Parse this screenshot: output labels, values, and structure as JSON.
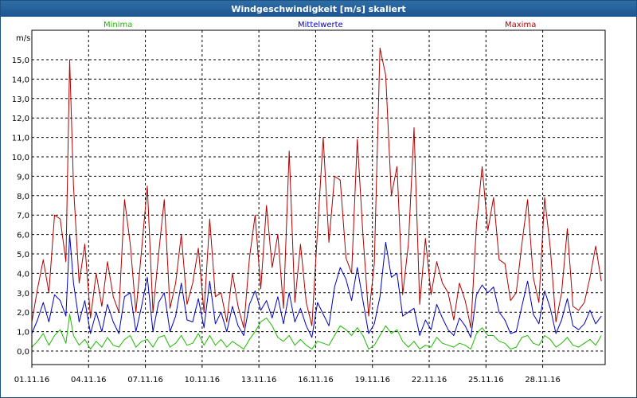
{
  "window": {
    "title": "Windgeschwindigkeit [m/s] skaliert"
  },
  "chart_data": {
    "type": "line",
    "title": "Windgeschwindigkeit [m/s] skaliert",
    "ylabel": "m/s",
    "xlabel": "",
    "ylim": [
      0,
      16
    ],
    "y_ticks": [
      "0,0",
      "1,0",
      "2,0",
      "3,0",
      "4,0",
      "5,0",
      "6,0",
      "7,0",
      "8,0",
      "9,0",
      "10,0",
      "11,0",
      "12,0",
      "13,0",
      "14,0",
      "15,0"
    ],
    "x_ticks": [
      "01.11.16",
      "04.11.16",
      "07.11.16",
      "10.11.16",
      "13.11.16",
      "16.11.16",
      "19.11.16",
      "22.11.16",
      "25.11.16",
      "28.11.16"
    ],
    "grid": true,
    "legend": "top",
    "x_day_range": [
      1,
      31.3
    ],
    "series": [
      {
        "name": "Minima",
        "color": "#1fb800",
        "x": [
          1.0,
          1.3,
          1.6,
          1.9,
          2.2,
          2.5,
          2.8,
          3.0,
          3.2,
          3.5,
          3.8,
          4.1,
          4.4,
          4.7,
          5.0,
          5.3,
          5.6,
          5.9,
          6.2,
          6.5,
          6.8,
          7.1,
          7.4,
          7.7,
          8.0,
          8.3,
          8.6,
          8.9,
          9.2,
          9.5,
          9.8,
          10.1,
          10.4,
          10.7,
          11.0,
          11.3,
          11.6,
          11.9,
          12.2,
          12.5,
          12.8,
          13.1,
          13.4,
          13.7,
          14.0,
          14.3,
          14.6,
          14.9,
          15.2,
          15.5,
          15.8,
          16.1,
          16.4,
          16.7,
          17.0,
          17.3,
          17.6,
          17.9,
          18.2,
          18.5,
          18.8,
          19.1,
          19.4,
          19.7,
          20.0,
          20.3,
          20.6,
          20.9,
          21.2,
          21.5,
          21.8,
          22.1,
          22.4,
          22.7,
          23.0,
          23.3,
          23.6,
          23.9,
          24.2,
          24.5,
          24.8,
          25.1,
          25.4,
          25.7,
          26.0,
          26.3,
          26.6,
          26.9,
          27.2,
          27.5,
          27.8,
          28.1,
          28.4,
          28.7,
          29.0,
          29.3,
          29.6,
          29.9,
          30.2,
          30.5,
          30.8,
          31.1
        ],
        "values": [
          0.2,
          0.5,
          0.9,
          0.3,
          0.8,
          1.1,
          0.4,
          1.9,
          0.8,
          0.3,
          0.6,
          0.1,
          0.5,
          0.2,
          0.7,
          0.3,
          0.2,
          0.6,
          0.8,
          0.2,
          0.5,
          0.6,
          0.2,
          0.7,
          0.8,
          0.2,
          0.4,
          0.8,
          0.3,
          0.4,
          0.9,
          0.3,
          0.8,
          0.3,
          0.6,
          0.2,
          0.5,
          0.3,
          0.1,
          0.6,
          1.0,
          1.5,
          1.7,
          1.3,
          0.7,
          0.5,
          0.8,
          0.3,
          0.6,
          0.3,
          0.1,
          0.5,
          0.4,
          0.3,
          0.8,
          1.3,
          1.1,
          0.8,
          1.2,
          0.8,
          0.1,
          0.3,
          0.8,
          1.3,
          0.9,
          1.1,
          0.5,
          0.2,
          0.5,
          0.1,
          0.3,
          0.2,
          0.7,
          0.4,
          0.3,
          0.2,
          0.4,
          0.3,
          0.1,
          0.9,
          1.2,
          0.8,
          0.8,
          0.5,
          0.4,
          0.1,
          0.2,
          0.7,
          0.8,
          0.4,
          0.3,
          0.8,
          0.6,
          0.2,
          0.4,
          0.7,
          0.3,
          0.2,
          0.4,
          0.6,
          0.3,
          0.8
        ]
      },
      {
        "name": "Mittelwerte",
        "color": "#0000c0",
        "x": [
          1.0,
          1.3,
          1.6,
          1.9,
          2.2,
          2.5,
          2.8,
          3.0,
          3.2,
          3.5,
          3.8,
          4.1,
          4.4,
          4.7,
          5.0,
          5.3,
          5.6,
          5.9,
          6.2,
          6.5,
          6.8,
          7.1,
          7.4,
          7.7,
          8.0,
          8.3,
          8.6,
          8.9,
          9.2,
          9.5,
          9.8,
          10.1,
          10.4,
          10.7,
          11.0,
          11.3,
          11.6,
          11.9,
          12.2,
          12.5,
          12.8,
          13.1,
          13.4,
          13.7,
          14.0,
          14.3,
          14.6,
          14.9,
          15.2,
          15.5,
          15.8,
          16.1,
          16.4,
          16.7,
          17.0,
          17.3,
          17.6,
          17.9,
          18.2,
          18.5,
          18.8,
          19.1,
          19.4,
          19.7,
          20.0,
          20.3,
          20.6,
          20.9,
          21.2,
          21.5,
          21.8,
          22.1,
          22.4,
          22.7,
          23.0,
          23.3,
          23.6,
          23.9,
          24.2,
          24.5,
          24.8,
          25.1,
          25.4,
          25.7,
          26.0,
          26.3,
          26.6,
          26.9,
          27.2,
          27.5,
          27.8,
          28.1,
          28.4,
          28.7,
          29.0,
          29.3,
          29.6,
          29.9,
          30.2,
          30.5,
          30.8,
          31.1
        ],
        "values": [
          0.9,
          1.6,
          2.5,
          1.5,
          2.9,
          2.6,
          1.8,
          6.0,
          3.5,
          1.5,
          2.6,
          0.9,
          2.0,
          1.0,
          2.4,
          1.5,
          0.9,
          2.8,
          3.0,
          1.0,
          2.3,
          3.8,
          1.0,
          2.5,
          3.0,
          1.0,
          1.8,
          3.5,
          1.6,
          1.5,
          2.7,
          1.2,
          3.6,
          1.4,
          2.0,
          1.0,
          2.3,
          1.3,
          0.8,
          2.4,
          3.1,
          2.1,
          2.6,
          1.7,
          2.8,
          1.4,
          3.0,
          1.5,
          2.2,
          1.3,
          0.7,
          2.5,
          1.9,
          1.3,
          3.3,
          4.3,
          3.7,
          2.6,
          4.3,
          2.6,
          0.9,
          1.4,
          2.8,
          5.6,
          3.8,
          4.0,
          1.8,
          2.0,
          2.2,
          0.8,
          1.6,
          1.1,
          2.4,
          1.7,
          1.1,
          0.8,
          1.7,
          1.3,
          0.7,
          2.9,
          3.4,
          3.0,
          3.3,
          2.0,
          1.6,
          0.9,
          1.0,
          2.3,
          3.6,
          1.9,
          1.4,
          3.1,
          2.2,
          0.9,
          1.6,
          2.7,
          1.3,
          1.1,
          1.4,
          2.1,
          1.4,
          1.8
        ]
      },
      {
        "name": "Maxima",
        "color": "#b00000",
        "x": [
          1.0,
          1.3,
          1.6,
          1.9,
          2.2,
          2.5,
          2.8,
          3.0,
          3.2,
          3.5,
          3.8,
          4.1,
          4.4,
          4.7,
          5.0,
          5.3,
          5.6,
          5.9,
          6.2,
          6.5,
          6.8,
          7.1,
          7.4,
          7.7,
          8.0,
          8.3,
          8.6,
          8.9,
          9.2,
          9.5,
          9.8,
          10.1,
          10.4,
          10.7,
          11.0,
          11.3,
          11.6,
          11.9,
          12.2,
          12.5,
          12.8,
          13.1,
          13.4,
          13.7,
          14.0,
          14.3,
          14.6,
          14.9,
          15.2,
          15.5,
          15.8,
          16.1,
          16.4,
          16.7,
          17.0,
          17.3,
          17.6,
          17.9,
          18.2,
          18.5,
          18.8,
          19.1,
          19.4,
          19.7,
          20.0,
          20.3,
          20.6,
          20.9,
          21.2,
          21.5,
          21.8,
          22.1,
          22.4,
          22.7,
          23.0,
          23.3,
          23.6,
          23.9,
          24.2,
          24.5,
          24.8,
          25.1,
          25.4,
          25.7,
          26.0,
          26.3,
          26.6,
          26.9,
          27.2,
          27.5,
          27.8,
          28.1,
          28.4,
          28.7,
          29.0,
          29.3,
          29.6,
          29.9,
          30.2,
          30.5,
          30.8,
          31.1
        ],
        "values": [
          1.5,
          3.2,
          4.7,
          3.0,
          7.0,
          6.8,
          4.6,
          15.0,
          8.5,
          3.5,
          5.5,
          1.7,
          4.0,
          2.3,
          4.6,
          2.8,
          2.0,
          7.8,
          5.5,
          2.0,
          5.2,
          8.5,
          2.0,
          5.0,
          7.8,
          2.2,
          3.5,
          6.0,
          2.4,
          3.5,
          5.3,
          2.0,
          6.8,
          2.8,
          3.0,
          1.5,
          4.0,
          2.3,
          1.2,
          4.8,
          7.0,
          3.2,
          7.5,
          4.3,
          6.0,
          2.2,
          10.3,
          2.5,
          5.5,
          2.5,
          1.3,
          6.2,
          11.0,
          5.6,
          9.0,
          8.8,
          4.8,
          4.0,
          10.9,
          6.0,
          1.8,
          4.5,
          15.6,
          14.2,
          8.0,
          9.5,
          2.9,
          5.5,
          11.5,
          2.4,
          5.8,
          2.9,
          4.6,
          3.5,
          3.0,
          1.6,
          3.5,
          2.6,
          1.2,
          6.5,
          9.5,
          6.2,
          7.9,
          4.7,
          4.5,
          2.6,
          3.0,
          5.5,
          7.8,
          3.8,
          2.5,
          7.9,
          5.3,
          1.5,
          3.0,
          6.3,
          2.3,
          2.1,
          2.5,
          3.8,
          5.4,
          3.6
        ]
      }
    ]
  }
}
